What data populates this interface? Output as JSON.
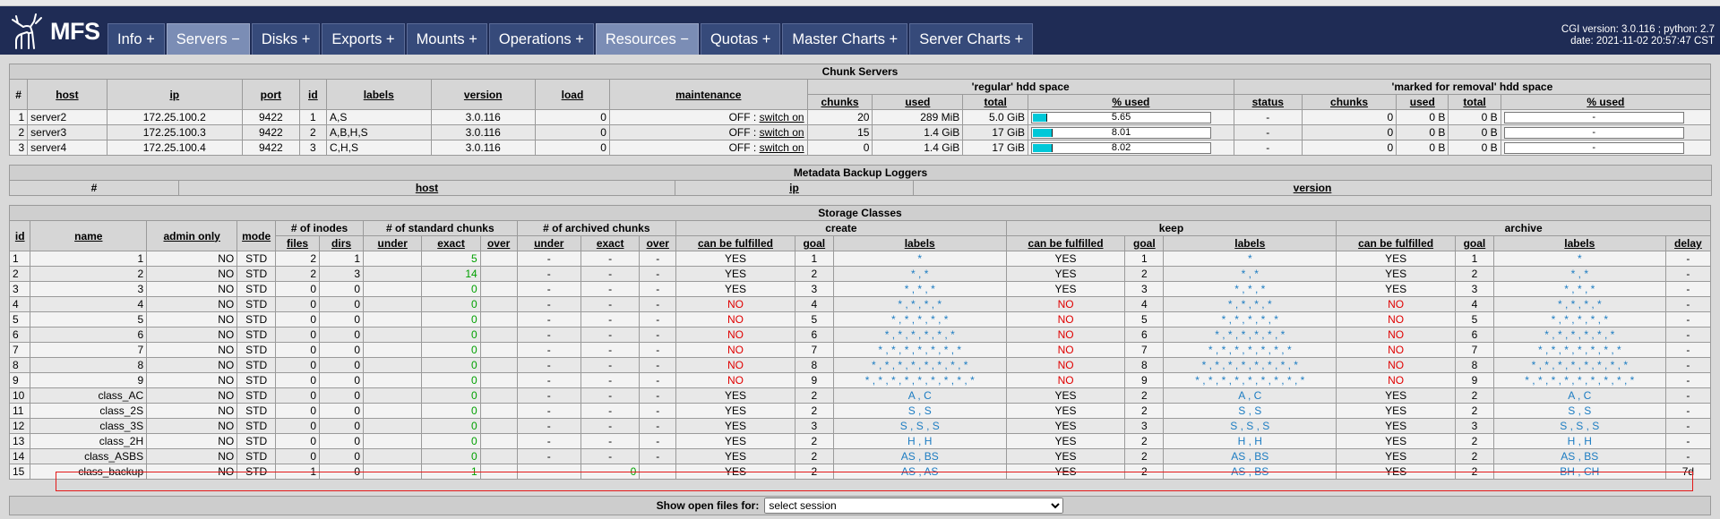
{
  "app": {
    "logo_text": "MFS",
    "tabs": [
      {
        "label": "Info +",
        "active": false
      },
      {
        "label": "Servers −",
        "active": true
      },
      {
        "label": "Disks +",
        "active": false
      },
      {
        "label": "Exports +",
        "active": false
      },
      {
        "label": "Mounts +",
        "active": false
      },
      {
        "label": "Operations +",
        "active": false
      },
      {
        "label": "Resources −",
        "active": true
      },
      {
        "label": "Quotas +",
        "active": false
      },
      {
        "label": "Master Charts +",
        "active": false
      },
      {
        "label": "Server Charts +",
        "active": false
      }
    ],
    "cgi_version": "CGI version: 3.0.116 ; python: 2.7",
    "date": "date: 2021-11-02 20:57:47 CST"
  },
  "chunk_servers": {
    "title": "Chunk Servers",
    "group_regular": "'regular' hdd space",
    "group_removal": "'marked for removal' hdd space",
    "headers": [
      "#",
      "host",
      "ip",
      "port",
      "id",
      "labels",
      "version",
      "load",
      "maintenance"
    ],
    "regular_headers": [
      "chunks",
      "used",
      "total",
      "% used"
    ],
    "removal_headers": [
      "status",
      "chunks",
      "used",
      "total",
      "% used"
    ],
    "rows": [
      {
        "num": "1",
        "host": "server2",
        "ip": "172.25.100.2",
        "port": "9422",
        "id": "1",
        "labels": "A,S",
        "version": "3.0.116",
        "load": "0",
        "maint": "OFF : ",
        "maint_link": "switch on",
        "chunks": "20",
        "used": "289 MiB",
        "total": "5.0 GiB",
        "pct": "5.65",
        "pct_value": 5.65,
        "r_status": "-",
        "r_chunks": "0",
        "r_used": "0 B",
        "r_total": "0 B",
        "r_pct": "-"
      },
      {
        "num": "2",
        "host": "server3",
        "ip": "172.25.100.3",
        "port": "9422",
        "id": "2",
        "labels": "A,B,H,S",
        "version": "3.0.116",
        "load": "0",
        "maint": "OFF : ",
        "maint_link": "switch on",
        "chunks": "15",
        "used": "1.4 GiB",
        "total": "17 GiB",
        "pct": "8.01",
        "pct_value": 8.01,
        "r_status": "-",
        "r_chunks": "0",
        "r_used": "0 B",
        "r_total": "0 B",
        "r_pct": "-"
      },
      {
        "num": "3",
        "host": "server4",
        "ip": "172.25.100.4",
        "port": "9422",
        "id": "3",
        "labels": "C,H,S",
        "version": "3.0.116",
        "load": "0",
        "maint": "OFF : ",
        "maint_link": "switch on",
        "chunks": "0",
        "used": "1.4 GiB",
        "total": "17 GiB",
        "pct": "8.02",
        "pct_value": 8.02,
        "r_status": "-",
        "r_chunks": "0",
        "r_used": "0 B",
        "r_total": "0 B",
        "r_pct": "-"
      }
    ]
  },
  "metadata_loggers": {
    "title": "Metadata Backup Loggers",
    "headers": [
      "#",
      "host",
      "ip",
      "version"
    ]
  },
  "storage_classes": {
    "title": "Storage Classes",
    "groups": {
      "inodes": "# of inodes",
      "standard": "# of standard chunks",
      "archived": "# of archived chunks",
      "create": "create",
      "keep": "keep",
      "archive": "archive"
    },
    "headers": {
      "id": "id",
      "name": "name",
      "admin_only": "admin only",
      "mode": "mode",
      "files": "files",
      "dirs": "dirs",
      "under": "under",
      "exact": "exact",
      "over": "over",
      "can_be_fulfilled": "can be fulfilled",
      "goal": "goal",
      "labels": "labels",
      "delay": "delay"
    },
    "rows": [
      {
        "id": "1",
        "name": "1",
        "admin": "NO",
        "mode": "STD",
        "files": "2",
        "dirs": "1",
        "s_under": "",
        "s_exact": "5",
        "s_over": "",
        "a_under": "-",
        "a_exact": "-",
        "a_over": "-",
        "c_ful": "YES",
        "c_ok": true,
        "c_goal": "1",
        "c_labels": "*",
        "k_ful": "YES",
        "k_ok": true,
        "k_goal": "1",
        "k_labels": "*",
        "ar_ful": "YES",
        "ar_ok": true,
        "ar_goal": "1",
        "ar_labels": "*",
        "delay": "-"
      },
      {
        "id": "2",
        "name": "2",
        "admin": "NO",
        "mode": "STD",
        "files": "2",
        "dirs": "3",
        "s_under": "",
        "s_exact": "14",
        "s_over": "",
        "a_under": "-",
        "a_exact": "-",
        "a_over": "-",
        "c_ful": "YES",
        "c_ok": true,
        "c_goal": "2",
        "c_labels": "* , *",
        "k_ful": "YES",
        "k_ok": true,
        "k_goal": "2",
        "k_labels": "* , *",
        "ar_ful": "YES",
        "ar_ok": true,
        "ar_goal": "2",
        "ar_labels": "* , *",
        "delay": "-"
      },
      {
        "id": "3",
        "name": "3",
        "admin": "NO",
        "mode": "STD",
        "files": "0",
        "dirs": "0",
        "s_under": "",
        "s_exact": "0",
        "s_over": "",
        "a_under": "-",
        "a_exact": "-",
        "a_over": "-",
        "c_ful": "YES",
        "c_ok": true,
        "c_goal": "3",
        "c_labels": "* , * , *",
        "k_ful": "YES",
        "k_ok": true,
        "k_goal": "3",
        "k_labels": "* , * , *",
        "ar_ful": "YES",
        "ar_ok": true,
        "ar_goal": "3",
        "ar_labels": "* , * , *",
        "delay": "-"
      },
      {
        "id": "4",
        "name": "4",
        "admin": "NO",
        "mode": "STD",
        "files": "0",
        "dirs": "0",
        "s_under": "",
        "s_exact": "0",
        "s_over": "",
        "a_under": "-",
        "a_exact": "-",
        "a_over": "-",
        "c_ful": "NO",
        "c_ok": false,
        "c_goal": "4",
        "c_labels": "* , * , * , *",
        "k_ful": "NO",
        "k_ok": false,
        "k_goal": "4",
        "k_labels": "* , * , * , *",
        "ar_ful": "NO",
        "ar_ok": false,
        "ar_goal": "4",
        "ar_labels": "* , * , * , *",
        "delay": "-"
      },
      {
        "id": "5",
        "name": "5",
        "admin": "NO",
        "mode": "STD",
        "files": "0",
        "dirs": "0",
        "s_under": "",
        "s_exact": "0",
        "s_over": "",
        "a_under": "-",
        "a_exact": "-",
        "a_over": "-",
        "c_ful": "NO",
        "c_ok": false,
        "c_goal": "5",
        "c_labels": "* , * , * , * , *",
        "k_ful": "NO",
        "k_ok": false,
        "k_goal": "5",
        "k_labels": "* , * , * , * , *",
        "ar_ful": "NO",
        "ar_ok": false,
        "ar_goal": "5",
        "ar_labels": "* , * , * , * , *",
        "delay": "-"
      },
      {
        "id": "6",
        "name": "6",
        "admin": "NO",
        "mode": "STD",
        "files": "0",
        "dirs": "0",
        "s_under": "",
        "s_exact": "0",
        "s_over": "",
        "a_under": "-",
        "a_exact": "-",
        "a_over": "-",
        "c_ful": "NO",
        "c_ok": false,
        "c_goal": "6",
        "c_labels": "* , * , * , * , * , *",
        "k_ful": "NO",
        "k_ok": false,
        "k_goal": "6",
        "k_labels": "* , * , * , * , * , *",
        "ar_ful": "NO",
        "ar_ok": false,
        "ar_goal": "6",
        "ar_labels": "* , * , * , * , * , *",
        "delay": "-"
      },
      {
        "id": "7",
        "name": "7",
        "admin": "NO",
        "mode": "STD",
        "files": "0",
        "dirs": "0",
        "s_under": "",
        "s_exact": "0",
        "s_over": "",
        "a_under": "-",
        "a_exact": "-",
        "a_over": "-",
        "c_ful": "NO",
        "c_ok": false,
        "c_goal": "7",
        "c_labels": "* , * , * , * , * , * , *",
        "k_ful": "NO",
        "k_ok": false,
        "k_goal": "7",
        "k_labels": "* , * , * , * , * , * , *",
        "ar_ful": "NO",
        "ar_ok": false,
        "ar_goal": "7",
        "ar_labels": "* , * , * , * , * , * , *",
        "delay": "-"
      },
      {
        "id": "8",
        "name": "8",
        "admin": "NO",
        "mode": "STD",
        "files": "0",
        "dirs": "0",
        "s_under": "",
        "s_exact": "0",
        "s_over": "",
        "a_under": "-",
        "a_exact": "-",
        "a_over": "-",
        "c_ful": "NO",
        "c_ok": false,
        "c_goal": "8",
        "c_labels": "* , * , * , * , * , * , * , *",
        "k_ful": "NO",
        "k_ok": false,
        "k_goal": "8",
        "k_labels": "* , * , * , * , * , * , * , *",
        "ar_ful": "NO",
        "ar_ok": false,
        "ar_goal": "8",
        "ar_labels": "* , * , * , * , * , * , * , *",
        "delay": "-"
      },
      {
        "id": "9",
        "name": "9",
        "admin": "NO",
        "mode": "STD",
        "files": "0",
        "dirs": "0",
        "s_under": "",
        "s_exact": "0",
        "s_over": "",
        "a_under": "-",
        "a_exact": "-",
        "a_over": "-",
        "c_ful": "NO",
        "c_ok": false,
        "c_goal": "9",
        "c_labels": "* , * , * , * , * , * , * , * , *",
        "k_ful": "NO",
        "k_ok": false,
        "k_goal": "9",
        "k_labels": "* , * , * , * , * , * , * , * , *",
        "ar_ful": "NO",
        "ar_ok": false,
        "ar_goal": "9",
        "ar_labels": "* , * , * , * , * , * , * , * , *",
        "delay": "-"
      },
      {
        "id": "10",
        "name": "class_AC",
        "admin": "NO",
        "mode": "STD",
        "files": "0",
        "dirs": "0",
        "s_under": "",
        "s_exact": "0",
        "s_over": "",
        "a_under": "-",
        "a_exact": "-",
        "a_over": "-",
        "c_ful": "YES",
        "c_ok": true,
        "c_goal": "2",
        "c_labels": "A , C",
        "k_ful": "YES",
        "k_ok": true,
        "k_goal": "2",
        "k_labels": "A , C",
        "ar_ful": "YES",
        "ar_ok": true,
        "ar_goal": "2",
        "ar_labels": "A , C",
        "delay": "-"
      },
      {
        "id": "11",
        "name": "class_2S",
        "admin": "NO",
        "mode": "STD",
        "files": "0",
        "dirs": "0",
        "s_under": "",
        "s_exact": "0",
        "s_over": "",
        "a_under": "-",
        "a_exact": "-",
        "a_over": "-",
        "c_ful": "YES",
        "c_ok": true,
        "c_goal": "2",
        "c_labels": "S , S",
        "k_ful": "YES",
        "k_ok": true,
        "k_goal": "2",
        "k_labels": "S , S",
        "ar_ful": "YES",
        "ar_ok": true,
        "ar_goal": "2",
        "ar_labels": "S , S",
        "delay": "-"
      },
      {
        "id": "12",
        "name": "class_3S",
        "admin": "NO",
        "mode": "STD",
        "files": "0",
        "dirs": "0",
        "s_under": "",
        "s_exact": "0",
        "s_over": "",
        "a_under": "-",
        "a_exact": "-",
        "a_over": "-",
        "c_ful": "YES",
        "c_ok": true,
        "c_goal": "3",
        "c_labels": "S , S , S",
        "k_ful": "YES",
        "k_ok": true,
        "k_goal": "3",
        "k_labels": "S , S , S",
        "ar_ful": "YES",
        "ar_ok": true,
        "ar_goal": "3",
        "ar_labels": "S , S , S",
        "delay": "-"
      },
      {
        "id": "13",
        "name": "class_2H",
        "admin": "NO",
        "mode": "STD",
        "files": "0",
        "dirs": "0",
        "s_under": "",
        "s_exact": "0",
        "s_over": "",
        "a_under": "-",
        "a_exact": "-",
        "a_over": "-",
        "c_ful": "YES",
        "c_ok": true,
        "c_goal": "2",
        "c_labels": "H , H",
        "k_ful": "YES",
        "k_ok": true,
        "k_goal": "2",
        "k_labels": "H , H",
        "ar_ful": "YES",
        "ar_ok": true,
        "ar_goal": "2",
        "ar_labels": "H , H",
        "delay": "-"
      },
      {
        "id": "14",
        "name": "class_ASBS",
        "admin": "NO",
        "mode": "STD",
        "files": "0",
        "dirs": "0",
        "s_under": "",
        "s_exact": "0",
        "s_over": "",
        "a_under": "-",
        "a_exact": "-",
        "a_over": "-",
        "c_ful": "YES",
        "c_ok": true,
        "c_goal": "2",
        "c_labels": "AS , BS",
        "k_ful": "YES",
        "k_ok": true,
        "k_goal": "2",
        "k_labels": "AS , BS",
        "ar_ful": "YES",
        "ar_ok": true,
        "ar_goal": "2",
        "ar_labels": "AS , BS",
        "delay": "-"
      },
      {
        "id": "15",
        "name": "class_backup",
        "admin": "NO",
        "mode": "STD",
        "files": "1",
        "dirs": "0",
        "s_under": "",
        "s_exact": "1",
        "s_over": "",
        "a_under": "",
        "a_exact": "0",
        "a_over": "",
        "c_ful": "YES",
        "c_ok": true,
        "c_goal": "2",
        "c_labels": "AS , AS",
        "k_ful": "YES",
        "k_ok": true,
        "k_goal": "2",
        "k_labels": "AS , BS",
        "ar_ful": "YES",
        "ar_ok": true,
        "ar_goal": "2",
        "ar_labels": "BH , CH",
        "delay": "7d"
      }
    ]
  },
  "footer": {
    "label": "Show open files for:",
    "select_value": "select session"
  },
  "colors": {
    "header_bg": "#1f2c55",
    "active_tab": "#7b8db5",
    "bar_fill": "#00c8d8",
    "ok_green": "#00a000",
    "bad_red": "#e00000",
    "label_blue": "#1c7cc2",
    "highlight": "#e41919"
  }
}
